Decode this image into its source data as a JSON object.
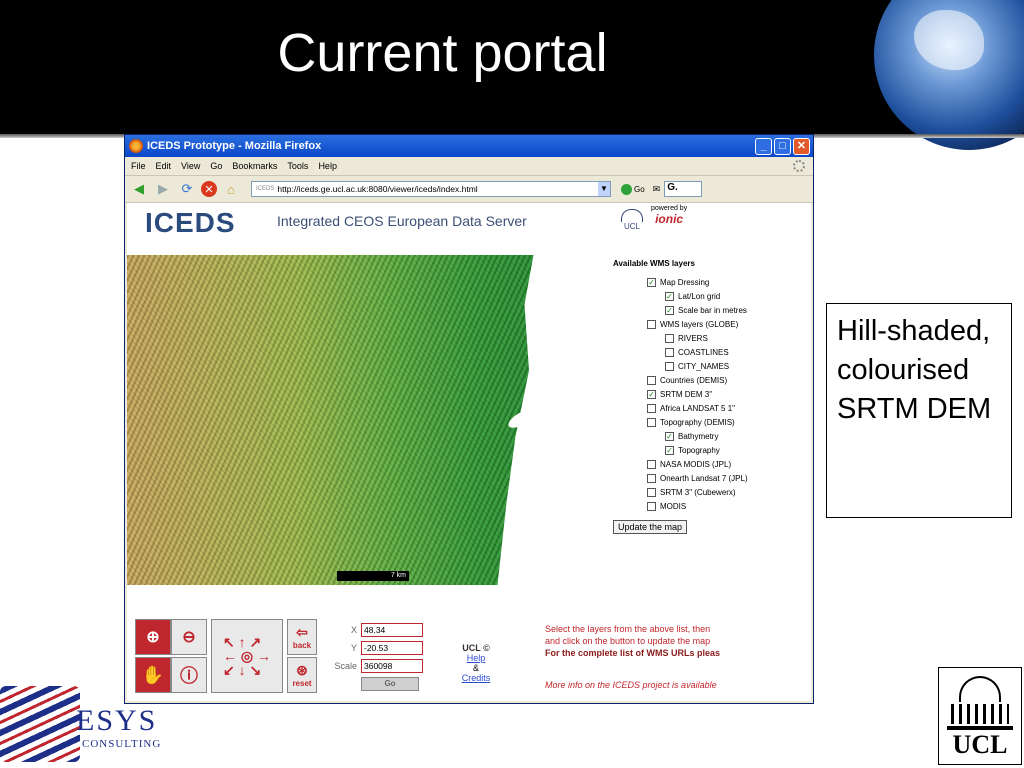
{
  "slide": {
    "title": "Current portal",
    "callout": "Hill-shaded, colourised SRTM DEM"
  },
  "browser": {
    "window_title": "ICEDS Prototype - Mozilla Firefox",
    "menus": [
      "File",
      "Edit",
      "View",
      "Go",
      "Bookmarks",
      "Tools",
      "Help"
    ],
    "url": "http://iceds.ge.ucl.ac.uk:8080/viewer/iceds/index.html",
    "url_prefix": "ICEDS",
    "go_label": "Go",
    "search_value": "G."
  },
  "page": {
    "logo": "ICEDS",
    "subtitle": "Integrated CEOS European Data Server",
    "ucl_small": "UCL",
    "powered_by": "powered by",
    "ionic": "ionic",
    "map_scale": "7 km",
    "layers_header": "Available WMS layers",
    "layers": [
      {
        "label": "Map Dressing",
        "checked": true,
        "level": 0
      },
      {
        "label": "Lat/Lon grid",
        "checked": true,
        "level": 1
      },
      {
        "label": "Scale bar in metres",
        "checked": true,
        "level": 1
      },
      {
        "label": "WMS layers (GLOBE)",
        "checked": false,
        "level": 0
      },
      {
        "label": "RIVERS",
        "checked": false,
        "level": 1
      },
      {
        "label": "COASTLINES",
        "checked": false,
        "level": 1
      },
      {
        "label": "CITY_NAMES",
        "checked": false,
        "level": 1
      },
      {
        "label": "Countries (DEMIS)",
        "checked": false,
        "level": 0
      },
      {
        "label": "SRTM DEM 3\"",
        "checked": true,
        "level": 0
      },
      {
        "label": "Africa LANDSAT 5 1\"",
        "checked": false,
        "level": 0
      },
      {
        "label": "Topography (DEMIS)",
        "checked": false,
        "level": 0
      },
      {
        "label": "Bathymetry",
        "checked": true,
        "level": 1
      },
      {
        "label": "Topography",
        "checked": true,
        "level": 1
      },
      {
        "label": "NASA MODIS (JPL)",
        "checked": false,
        "level": 0
      },
      {
        "label": "Onearth Landsat 7 (JPL)",
        "checked": false,
        "level": 0
      },
      {
        "label": "SRTM 3\" (Cubewerx)",
        "checked": false,
        "level": 0
      },
      {
        "label": "MODIS",
        "checked": false,
        "level": 0
      }
    ],
    "update_button": "Update the map",
    "coords": {
      "x_label": "X",
      "x_value": "48.34",
      "y_label": "Y",
      "y_value": "-20.53",
      "scale_label": "Scale",
      "scale_value": "360098",
      "go": "Go"
    },
    "nav": {
      "back": "back",
      "reset": "reset"
    },
    "ucl_text": "UCL ©",
    "help": "Help",
    "amp": "&",
    "credits": "Credits",
    "info_line1": "Select the layers from the above list, then",
    "info_line2": "and click on the button to update the map",
    "info_line3": "For the complete list of WMS URLs pleas",
    "info_line4": "More info on the ICEDS project is available"
  },
  "logos": {
    "esys": "ESYS",
    "consulting": "CONSULTING",
    "ucl": "UCL"
  }
}
